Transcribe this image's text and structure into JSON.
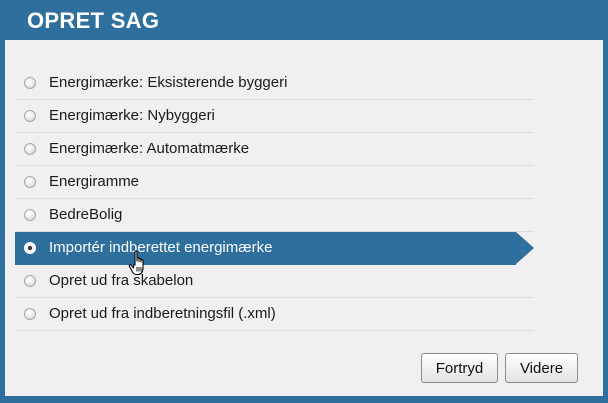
{
  "dialog": {
    "title": "OPRET SAG"
  },
  "options": [
    {
      "label": "Energimærke: Eksisterende byggeri",
      "selected": false
    },
    {
      "label": "Energimærke: Nybyggeri",
      "selected": false
    },
    {
      "label": "Energimærke: Automatmærke",
      "selected": false
    },
    {
      "label": "Energiramme",
      "selected": false
    },
    {
      "label": "BedreBolig",
      "selected": false
    },
    {
      "label": "Importér indberettet energimærke",
      "selected": true
    },
    {
      "label": "Opret ud fra skabelon",
      "selected": false
    },
    {
      "label": "Opret ud fra indberetningsfil (.xml)",
      "selected": false
    }
  ],
  "buttons": {
    "cancel_label": "Fortryd",
    "next_label": "Videre"
  },
  "colors": {
    "accent": "#2e6f9e",
    "panel_background": "#f1eff1"
  },
  "cursor": {
    "icon": "hand-pointer-icon"
  }
}
